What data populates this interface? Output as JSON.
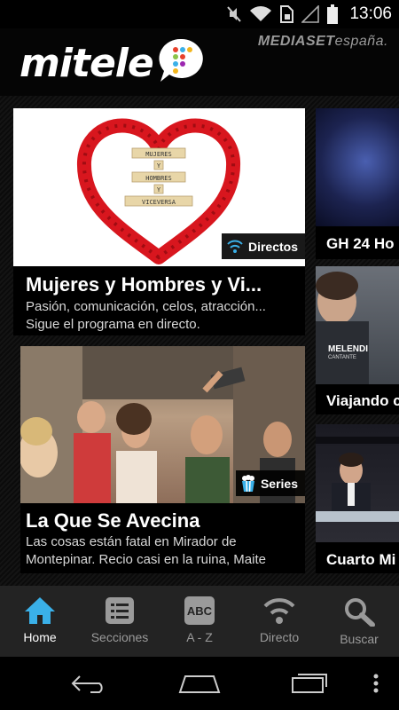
{
  "status": {
    "time": "13:06"
  },
  "header": {
    "logo": "mitele",
    "brand_main": "MEDIASET",
    "brand_sub": "españa."
  },
  "cards": [
    {
      "title": "Mujeres y Hombres y Vi...",
      "description": "Pasión, comunicación, celos, atracción... Sigue el programa en directo.",
      "badge": "Directos",
      "badge_icon": "live-signal-icon",
      "image_tiles": [
        "MUJERES",
        "Y",
        "HOMBRES",
        "Y",
        "VICEVERSA"
      ]
    },
    {
      "title": "La Que Se Avecina",
      "description": "Las cosas están fatal en Mirador de Montepinar. Recio casi en la ruina, Maite",
      "badge": "Series",
      "badge_icon": "popcorn-icon"
    }
  ],
  "side_cards": [
    {
      "title": "GH 24 Ho"
    },
    {
      "title": "Viajando c",
      "overlay_name": "MELENDI",
      "overlay_sub": "CANTANTE"
    },
    {
      "title": "Cuarto Mi"
    }
  ],
  "bottom_nav": [
    {
      "label": "Home",
      "icon": "home-icon",
      "active": true
    },
    {
      "label": "Secciones",
      "icon": "sections-list-icon",
      "active": false
    },
    {
      "label": "A - Z",
      "icon": "abc-icon",
      "active": false,
      "icon_text": "ABC"
    },
    {
      "label": "Directo",
      "icon": "live-signal-icon",
      "active": false
    },
    {
      "label": "Buscar",
      "icon": "search-icon",
      "active": false
    }
  ],
  "colors": {
    "accent": "#3ab0e8",
    "nav_bg": "#232323",
    "inactive": "#9a9a9a"
  }
}
